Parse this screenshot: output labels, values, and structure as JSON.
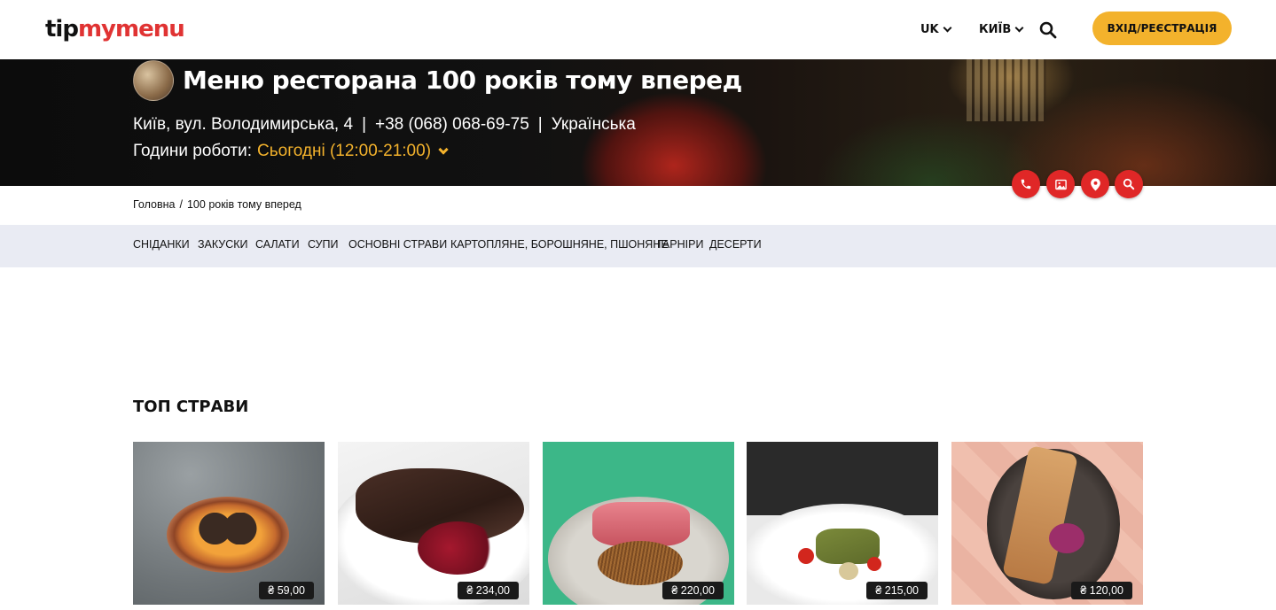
{
  "header": {
    "logo_tip": "tip",
    "logo_mymenu": "mymenu",
    "lang": "UK",
    "city": "КИЇВ",
    "login_label": "ВХІД/РЕЄСТРАЦІЯ",
    "icons": [
      "chevron-down-icon",
      "search-icon"
    ]
  },
  "restaurant": {
    "title": "Меню ресторана 100 років тому вперед",
    "address": "Київ, вул. Володимирська, 4",
    "phone": "+38 (068) 068-69-75",
    "cuisine": "Українська",
    "separator": "|",
    "hours_label": "Години роботи:",
    "hours_value": "Сьогодні (12:00-21:00)"
  },
  "actions": [
    "phone-icon",
    "image-icon",
    "location-pin-icon",
    "search-icon"
  ],
  "breadcrumb": {
    "home": "Головна",
    "separator": "/",
    "current": "100 років тому вперед"
  },
  "categories": [
    "СНІДАНКИ",
    "ЗАКУСКИ",
    "САЛАТИ",
    "СУПИ",
    "ОСНОВНІ СТРАВИ",
    "КАРТОПЛЯНЕ, БОРОШНЯНЕ, ПШОНЯНЕ",
    "ГАРНІРИ",
    "ДЕСЕРТИ"
  ],
  "top_dishes": {
    "title": "ТОП СТРАВИ",
    "items": [
      {
        "price": "₴ 59,00"
      },
      {
        "price": "₴ 234,00"
      },
      {
        "price": "₴ 220,00"
      },
      {
        "price": "₴ 215,00"
      },
      {
        "price": "₴ 120,00"
      }
    ]
  },
  "colors": {
    "accent": "#f3b22c",
    "brand_red": "#e03333",
    "action_red": "#e02727",
    "category_bar": "#e9ebf3"
  }
}
